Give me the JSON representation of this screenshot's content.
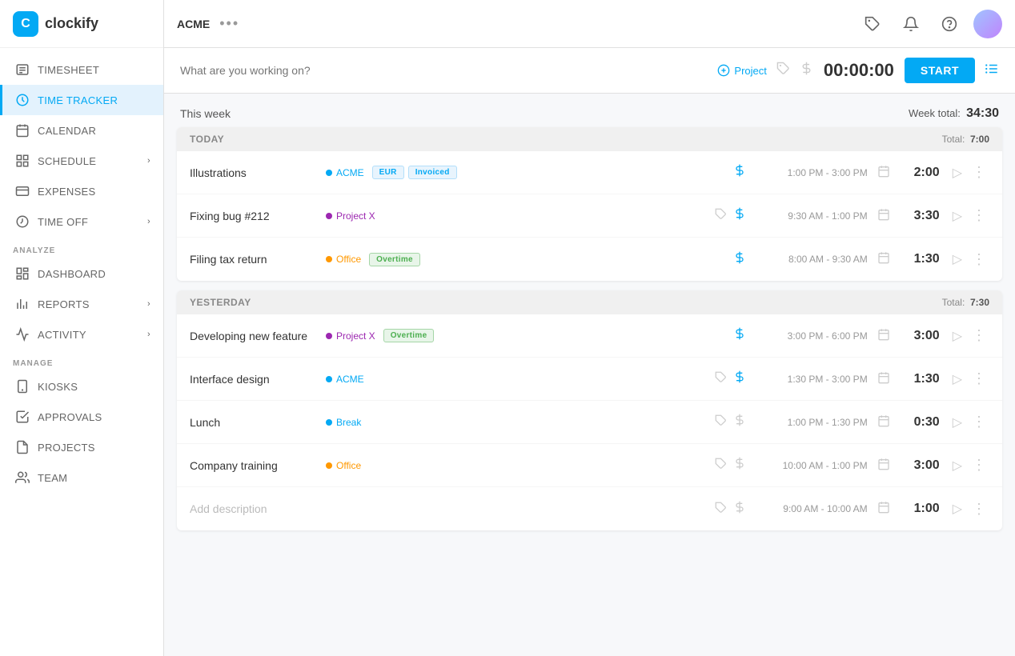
{
  "app": {
    "name": "clockify",
    "workspace": "ACME",
    "dots_label": "•••"
  },
  "sidebar": {
    "items": [
      {
        "id": "timesheet",
        "label": "TIMESHEET",
        "icon": "timesheet-icon",
        "active": false,
        "hasChevron": false
      },
      {
        "id": "time-tracker",
        "label": "TIME TRACKER",
        "icon": "time-tracker-icon",
        "active": true,
        "hasChevron": false
      },
      {
        "id": "calendar",
        "label": "CALENDAR",
        "icon": "calendar-icon",
        "active": false,
        "hasChevron": false
      },
      {
        "id": "schedule",
        "label": "SCHEDULE",
        "icon": "schedule-icon",
        "active": false,
        "hasChevron": true
      },
      {
        "id": "expenses",
        "label": "EXPENSES",
        "icon": "expenses-icon",
        "active": false,
        "hasChevron": false
      },
      {
        "id": "time-off",
        "label": "TIME OFF",
        "icon": "time-off-icon",
        "active": false,
        "hasChevron": true
      }
    ],
    "analyze_label": "ANALYZE",
    "analyze_items": [
      {
        "id": "dashboard",
        "label": "DASHBOARD",
        "icon": "dashboard-icon",
        "hasChevron": false
      },
      {
        "id": "reports",
        "label": "REPORTS",
        "icon": "reports-icon",
        "hasChevron": true
      },
      {
        "id": "activity",
        "label": "ACTIVITY",
        "icon": "activity-icon",
        "hasChevron": true
      }
    ],
    "manage_label": "MANAGE",
    "manage_items": [
      {
        "id": "kiosks",
        "label": "KIOSKS",
        "icon": "kiosks-icon",
        "hasChevron": false
      },
      {
        "id": "approvals",
        "label": "APPROVALS",
        "icon": "approvals-icon",
        "hasChevron": false
      },
      {
        "id": "projects",
        "label": "PROJECTS",
        "icon": "projects-icon",
        "hasChevron": false
      },
      {
        "id": "team",
        "label": "TEAM",
        "icon": "team-icon",
        "hasChevron": false
      }
    ]
  },
  "timer": {
    "placeholder": "What are you working on?",
    "project_label": "Project",
    "time_display": "00:00:00",
    "start_label": "START"
  },
  "week": {
    "label": "This week",
    "total_label": "Week total:",
    "total_time": "34:30"
  },
  "today": {
    "label": "Today",
    "total_label": "Total:",
    "total_time": "7:00",
    "entries": [
      {
        "description": "Illustrations",
        "project": "ACME",
        "project_color": "#03a9f4",
        "badges": [
          "EUR",
          "Invoiced"
        ],
        "billable": true,
        "time_range": "1:00 PM - 3:00 PM",
        "duration": "2:00"
      },
      {
        "description": "Fixing bug #212",
        "project": "Project X",
        "project_color": "#9c27b0",
        "badges": [],
        "billable": true,
        "time_range": "9:30 AM - 1:00 PM",
        "duration": "3:30"
      },
      {
        "description": "Filing tax return",
        "project": "Office",
        "project_color": "#ff9800",
        "badges": [
          "Overtime"
        ],
        "billable": true,
        "time_range": "8:00 AM - 9:30 AM",
        "duration": "1:30"
      }
    ]
  },
  "yesterday": {
    "label": "Yesterday",
    "total_label": "Total:",
    "total_time": "7:30",
    "entries": [
      {
        "description": "Developing new feature",
        "project": "Project X",
        "project_color": "#9c27b0",
        "badges": [
          "Overtime"
        ],
        "billable": true,
        "time_range": "3:00 PM - 6:00 PM",
        "duration": "3:00"
      },
      {
        "description": "Interface design",
        "project": "ACME",
        "project_color": "#03a9f4",
        "badges": [],
        "billable": true,
        "time_range": "1:30 PM - 3:00 PM",
        "duration": "1:30"
      },
      {
        "description": "Lunch",
        "project": "Break",
        "project_color": "#03a9f4",
        "badges": [],
        "billable": false,
        "time_range": "1:00 PM - 1:30 PM",
        "duration": "0:30"
      },
      {
        "description": "Company training",
        "project": "Office",
        "project_color": "#ff9800",
        "badges": [],
        "billable": false,
        "time_range": "10:00 AM - 1:00 PM",
        "duration": "3:00"
      },
      {
        "description": "",
        "placeholder": "Add description",
        "project": "",
        "project_color": "",
        "badges": [],
        "billable": false,
        "time_range": "9:00 AM - 10:00 AM",
        "duration": "1:00"
      }
    ]
  }
}
